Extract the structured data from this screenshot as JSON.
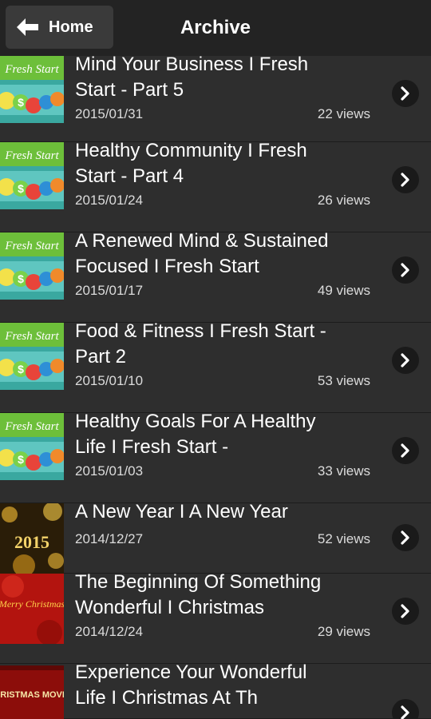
{
  "nav": {
    "home_label": "Home",
    "title": "Archive",
    "back_icon": "arrow-left-icon"
  },
  "items": [
    {
      "title_line1": "Mind Your Business I Fresh",
      "title_line2": "Start - Part 5",
      "date": "2015/01/31",
      "views": "22 views",
      "thumb": "fresh-start"
    },
    {
      "title_line1": "Healthy Community I Fresh",
      "title_line2": "Start - Part 4",
      "date": "2015/01/24",
      "views": "26 views",
      "thumb": "fresh-start"
    },
    {
      "title_line1": "A Renewed Mind & Sustained",
      "title_line2": "Focused I Fresh Start",
      "date": "2015/01/17",
      "views": "49 views",
      "thumb": "fresh-start"
    },
    {
      "title_line1": "Food & Fitness I Fresh Start -",
      "title_line2": "Part 2",
      "date": "2015/01/10",
      "views": "53 views",
      "thumb": "fresh-start"
    },
    {
      "title_line1": "Healthy Goals For A Healthy",
      "title_line2": "Life I Fresh Start -",
      "date": "2015/01/03",
      "views": "33 views",
      "thumb": "fresh-start"
    },
    {
      "title_line1": "A New Year I A New Year",
      "title_line2": "",
      "date": "2014/12/27",
      "views": "52 views",
      "thumb": "new-year",
      "thumb_text": "2015"
    },
    {
      "title_line1": "The Beginning Of Something",
      "title_line2": "Wonderful I Christmas",
      "date": "2014/12/24",
      "views": "29 views",
      "thumb": "merry-christmas",
      "thumb_text": "Merry Christmas"
    },
    {
      "title_line1": "Experience Your Wonderful",
      "title_line2": "Life I Christmas At Th",
      "date": "",
      "views": "",
      "thumb": "christmas-movies",
      "thumb_text": "CHRISTMAS MOVIES"
    }
  ],
  "fresh_start_text": "Fresh Start"
}
